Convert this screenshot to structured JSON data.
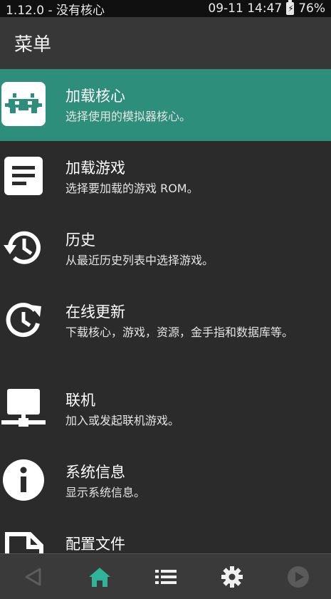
{
  "status": {
    "left": "1.12.0 - 没有核心",
    "time": "09-11 14:47",
    "battery": "76%"
  },
  "header": {
    "title": "菜单"
  },
  "menu": {
    "items": [
      {
        "label": "加载核心",
        "desc": "选择使用的模拟器核心。",
        "icon": "retroarch-invader-icon"
      },
      {
        "label": "加载游戏",
        "desc": "选择要加载的游戏 ROM。",
        "icon": "document-icon"
      },
      {
        "label": "历史",
        "desc": "从最近历史列表中选择游戏。",
        "icon": "history-icon"
      },
      {
        "label": "在线更新",
        "desc": "下载核心，游戏，资源，金手指和数据库等。",
        "icon": "update-icon"
      },
      {
        "label": "联机",
        "desc": "加入或发起联机游戏。",
        "icon": "network-icon"
      },
      {
        "label": "系统信息",
        "desc": "显示系统信息。",
        "icon": "info-icon"
      },
      {
        "label": "配置文件",
        "desc": "",
        "icon": "config-file-icon"
      }
    ]
  },
  "colors": {
    "accent": "#2d8e7b",
    "background": "#2b2b2b",
    "header": "#373737",
    "nav_active": "#2fb39a"
  }
}
